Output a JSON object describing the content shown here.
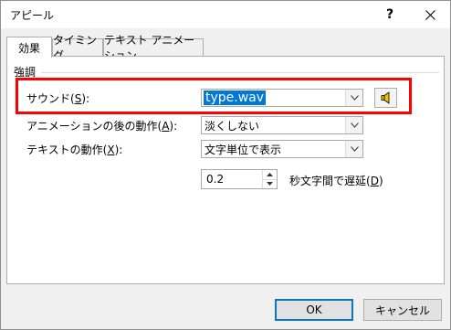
{
  "window": {
    "title": "アピール",
    "help": "?",
    "close_icon": "close-icon"
  },
  "tabs": [
    {
      "label": "効果",
      "active": true
    },
    {
      "label": "タイミング",
      "active": false
    },
    {
      "label": "テキスト アニメーション",
      "active": false
    }
  ],
  "enhancement": {
    "group_label": "強調",
    "sound": {
      "label_pre": "サウンド(",
      "accel": "S",
      "label_post": "):",
      "value": "type.wav",
      "speaker_icon": "speaker-icon"
    },
    "after_animation": {
      "label_pre": "アニメーションの後の動作(",
      "accel": "A",
      "label_post": "):",
      "value": "淡くしない"
    },
    "text_animate": {
      "label_pre": "テキストの動作(",
      "accel": "X",
      "label_post": "):",
      "value": "文字単位で表示"
    },
    "delay": {
      "value": "0.2",
      "label_pre": "秒文字間で遅延(",
      "accel": "D",
      "label_post": ")"
    }
  },
  "buttons": {
    "ok": "OK",
    "cancel": "キャンセル"
  },
  "colors": {
    "highlight": "#ff0000",
    "selection": "#0078d7"
  }
}
